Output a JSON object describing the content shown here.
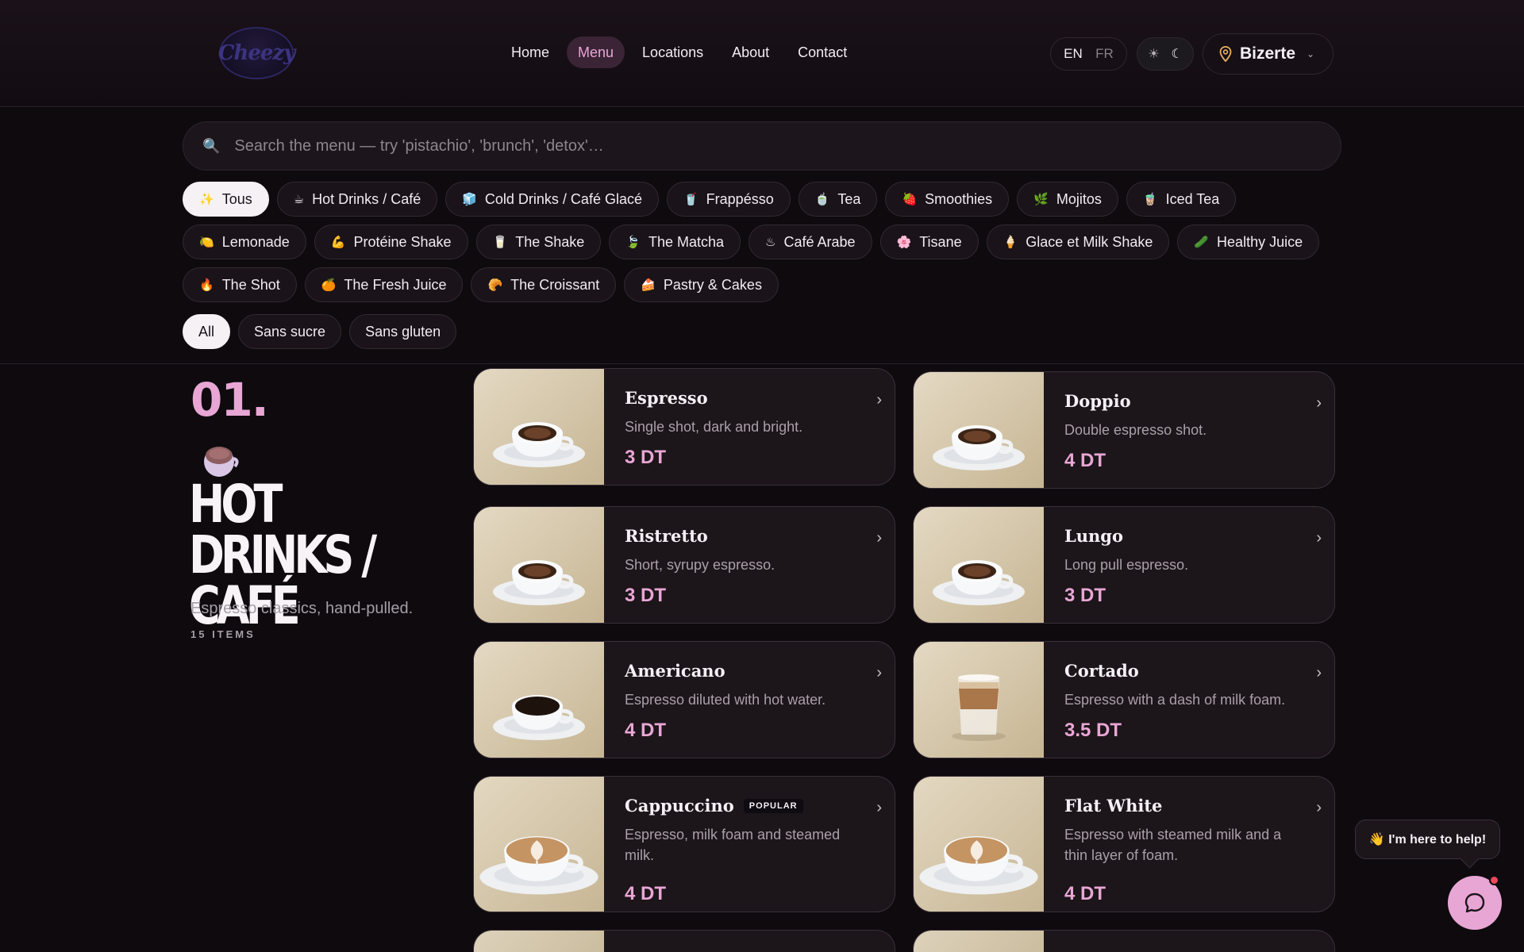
{
  "header": {
    "logo_text": "Cheezy",
    "nav": [
      {
        "label": "Home"
      },
      {
        "label": "Menu"
      },
      {
        "label": "Locations"
      },
      {
        "label": "About"
      },
      {
        "label": "Contact"
      }
    ],
    "active_nav": "Menu",
    "lang_en": "EN",
    "lang_fr": "FR",
    "theme_light_icon": "☀",
    "theme_dark_icon": "☾",
    "location": "Bizerte",
    "location_chevron": "⌄"
  },
  "search": {
    "placeholder": "Search the menu — try 'pistachio', 'brunch', 'detox'…",
    "value": ""
  },
  "categories": [
    {
      "emoji": "✨",
      "label": "Tous"
    },
    {
      "emoji": "☕",
      "label": "Hot Drinks / Café"
    },
    {
      "emoji": "🧊",
      "label": "Cold Drinks / Café Glacé"
    },
    {
      "emoji": "🥤",
      "label": "Frappésso"
    },
    {
      "emoji": "🍵",
      "label": "Tea"
    },
    {
      "emoji": "🍓",
      "label": "Smoothies"
    },
    {
      "emoji": "🌿",
      "label": "Mojitos"
    },
    {
      "emoji": "🧋",
      "label": "Iced Tea"
    },
    {
      "emoji": "🍋",
      "label": "Lemonade"
    },
    {
      "emoji": "💪",
      "label": "Protéine Shake"
    },
    {
      "emoji": "🥛",
      "label": "The Shake"
    },
    {
      "emoji": "🍃",
      "label": "The Matcha"
    },
    {
      "emoji": "♨",
      "label": "Café Arabe"
    },
    {
      "emoji": "🌸",
      "label": "Tisane"
    },
    {
      "emoji": "🍦",
      "label": "Glace et Milk Shake"
    },
    {
      "emoji": "🥒",
      "label": "Healthy Juice"
    },
    {
      "emoji": "🔥",
      "label": "The Shot"
    },
    {
      "emoji": "🍊",
      "label": "The Fresh Juice"
    },
    {
      "emoji": "🥐",
      "label": "The Croissant"
    },
    {
      "emoji": "🍰",
      "label": "Pastry & Cakes"
    }
  ],
  "active_category": "Tous",
  "diet_filters": [
    "All",
    "Sans sucre",
    "Sans gluten"
  ],
  "active_diet": "All",
  "section": {
    "number": "01.",
    "title": "Hot Drinks / Café",
    "description": "Espresso classics, hand-pulled.",
    "count": "15 ITEMS"
  },
  "items": [
    {
      "name": "Espresso",
      "desc": "Single shot, dark and bright.",
      "price": "3 DT",
      "badge": "",
      "cup": "espresso"
    },
    {
      "name": "Doppio",
      "desc": "Double espresso shot.",
      "price": "4 DT",
      "badge": "",
      "cup": "espresso"
    },
    {
      "name": "Ristretto",
      "desc": "Short, syrupy espresso.",
      "price": "3 DT",
      "badge": "",
      "cup": "espresso"
    },
    {
      "name": "Lungo",
      "desc": "Long pull espresso.",
      "price": "3 DT",
      "badge": "",
      "cup": "espresso"
    },
    {
      "name": "Americano",
      "desc": "Espresso diluted with hot water.",
      "price": "4 DT",
      "badge": "",
      "cup": "black"
    },
    {
      "name": "Cortado",
      "desc": "Espresso with a dash of milk foam.",
      "price": "3.5 DT",
      "badge": "",
      "cup": "glass"
    },
    {
      "name": "Cappuccino",
      "desc": "Espresso, milk foam and steamed milk.",
      "price": "4 DT",
      "badge": "POPULAR",
      "cup": "latte"
    },
    {
      "name": "Flat White",
      "desc": "Espresso with steamed milk and a thin layer of foam.",
      "price": "4 DT",
      "badge": "",
      "cup": "latte"
    }
  ],
  "help": {
    "tip": "👋 I'm here to help!"
  },
  "colors": {
    "accent": "#e8a6d5",
    "background": "#0e0a0e",
    "card": "#1c1519",
    "notification": "#f0455a"
  }
}
